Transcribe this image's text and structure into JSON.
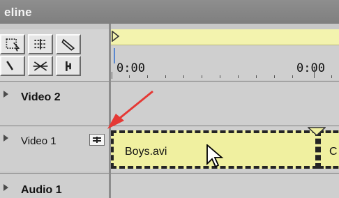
{
  "title": "eline",
  "tools": [
    {
      "name": "range-select-icon"
    },
    {
      "name": "multi-track-select-icon"
    },
    {
      "name": "razor-tool-icon"
    },
    {
      "name": "zoom-tool-icon"
    },
    {
      "name": "cross-fade-icon"
    },
    {
      "name": "in-out-point-icon"
    }
  ],
  "ruler": {
    "start_time": "0:00",
    "next_time": "0:00"
  },
  "tracks": {
    "video2": {
      "label": "Video 2"
    },
    "video1": {
      "label": "Video 1"
    },
    "audio1": {
      "label": "Audio 1"
    }
  },
  "clips": [
    {
      "name": "Boys.avi"
    },
    {
      "name": "C"
    }
  ],
  "colors": {
    "titlebar": "#8e8e8e",
    "panel": "#cfcfcf",
    "work_area": "#f3f3ae",
    "clip_fill": "#f0f0a0",
    "arrow": "#e53935"
  }
}
